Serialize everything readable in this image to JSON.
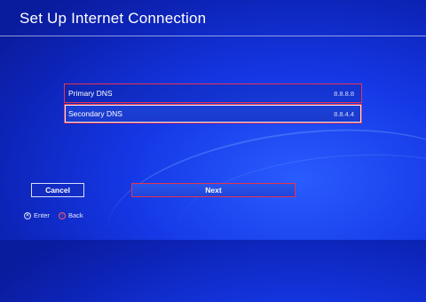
{
  "header": {
    "title": "Set Up Internet Connection"
  },
  "dns": {
    "primary": {
      "label": "Primary DNS",
      "value": "8.8.8.8"
    },
    "secondary": {
      "label": "Secondary DNS",
      "value": "8.8.4.4"
    }
  },
  "buttons": {
    "cancel": "Cancel",
    "next": "Next"
  },
  "footer": {
    "enter": {
      "icon": "cross-button-icon",
      "label": "Enter"
    },
    "back": {
      "icon": "circle-button-icon",
      "label": "Back"
    }
  },
  "colors": {
    "background": "#1538e6",
    "highlight": "#e8334a"
  }
}
